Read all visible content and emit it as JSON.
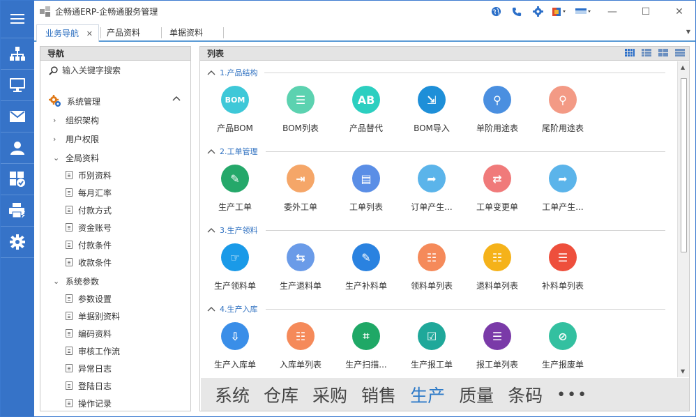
{
  "window": {
    "title": "企畅通ERP-企畅通服务管理",
    "minimize": "—",
    "maximize": "☐",
    "close": "✕"
  },
  "colors": {
    "rail": "#3673c8",
    "accent": "#2d6fc0"
  },
  "rail_items": [
    "menu-icon",
    "org-chart-icon",
    "monitor-icon",
    "mail-icon",
    "user-icon",
    "apps-check-icon",
    "printer-icon",
    "gear-icon"
  ],
  "tabs": [
    {
      "label": "业务导航",
      "active": true,
      "close": "✕"
    },
    {
      "label": "产品资料",
      "active": false
    },
    {
      "label": "单据资料",
      "active": false
    }
  ],
  "nav": {
    "title": "导航",
    "search_placeholder": "输入关键字搜索",
    "root": "系统管理",
    "items": [
      {
        "label": "组织架构",
        "arrow": "›"
      },
      {
        "label": "用户权限",
        "arrow": "›"
      },
      {
        "label": "全局资料",
        "arrow": "⌄"
      },
      {
        "label": "币别资料"
      },
      {
        "label": "每月汇率"
      },
      {
        "label": "付款方式"
      },
      {
        "label": "资金账号"
      },
      {
        "label": "付款条件"
      },
      {
        "label": "收款条件"
      },
      {
        "label": "系统参数",
        "arrow": "⌄"
      },
      {
        "label": "参数设置"
      },
      {
        "label": "单据别资料"
      },
      {
        "label": "编码资料"
      },
      {
        "label": "审核工作流"
      },
      {
        "label": "异常日志"
      },
      {
        "label": "登陆日志"
      },
      {
        "label": "操作记录"
      }
    ]
  },
  "list": {
    "title": "列表",
    "sections": [
      {
        "title": "1.产品结构",
        "tiles": [
          {
            "label": "产品BOM",
            "icon": "bom-icon",
            "color": "#3ec8d8",
            "glyph": "BOM"
          },
          {
            "label": "BOM列表",
            "icon": "bom-list-icon",
            "color": "#5cd2b0",
            "glyph": "☰"
          },
          {
            "label": "产品替代",
            "icon": "substitute-icon",
            "color": "#2ccfc0",
            "glyph": "AB"
          },
          {
            "label": "BOM导入",
            "icon": "import-icon",
            "color": "#1e8fd8",
            "glyph": "⇲"
          },
          {
            "label": "单阶用途表",
            "icon": "single-usage-icon",
            "color": "#4a8fe0",
            "glyph": "⚲"
          },
          {
            "label": "尾阶用途表",
            "icon": "tail-usage-icon",
            "color": "#f39a85",
            "glyph": "⚲"
          }
        ]
      },
      {
        "title": "2.工单管理",
        "tiles": [
          {
            "label": "生产工单",
            "icon": "work-order-icon",
            "color": "#25a86a",
            "glyph": "✎"
          },
          {
            "label": "委外工单",
            "icon": "outsource-icon",
            "color": "#f5a668",
            "glyph": "⇥"
          },
          {
            "label": "工单列表",
            "icon": "order-list-icon",
            "color": "#5a8ee6",
            "glyph": "▤"
          },
          {
            "label": "订单产生...",
            "icon": "share-arrow-icon",
            "color": "#5bb4ea",
            "glyph": "➦"
          },
          {
            "label": "工单变更单",
            "icon": "exchange-icon",
            "color": "#f07a7a",
            "glyph": "⇄"
          },
          {
            "label": "工单产生...",
            "icon": "share-arrow-icon",
            "color": "#5bb4ea",
            "glyph": "➦"
          }
        ]
      },
      {
        "title": "3.生产领料",
        "tiles": [
          {
            "label": "生产领料单",
            "icon": "pick-icon",
            "color": "#1a9ae8",
            "glyph": "☞"
          },
          {
            "label": "生产退料单",
            "icon": "return-icon",
            "color": "#6a9be8",
            "glyph": "⇆"
          },
          {
            "label": "生产补料单",
            "icon": "supplement-icon",
            "color": "#2a82e0",
            "glyph": "✎"
          },
          {
            "label": "领料单列表",
            "icon": "pick-list-icon",
            "color": "#f58a5a",
            "glyph": "☷"
          },
          {
            "label": "退料单列表",
            "icon": "return-list-icon",
            "color": "#f5b21a",
            "glyph": "☷"
          },
          {
            "label": "补料单列表",
            "icon": "supplement-list-icon",
            "color": "#ee4f3c",
            "glyph": "☰"
          }
        ]
      },
      {
        "title": "4.生产入库",
        "tiles": [
          {
            "label": "生产入库单",
            "icon": "inbound-icon",
            "color": "#3a8ee8",
            "glyph": "⇩"
          },
          {
            "label": "入库单列表",
            "icon": "inbound-list-icon",
            "color": "#f58a5a",
            "glyph": "☷"
          },
          {
            "label": "生产扫描...",
            "icon": "scan-icon",
            "color": "#1fa866",
            "glyph": "⌗"
          },
          {
            "label": "生产报工单",
            "icon": "report-icon",
            "color": "#1fa89a",
            "glyph": "☑"
          },
          {
            "label": "报工单列表",
            "icon": "report-list-icon",
            "color": "#7a3aa8",
            "glyph": "☰"
          },
          {
            "label": "生产报废单",
            "icon": "scrap-icon",
            "color": "#33c0a0",
            "glyph": "⊘"
          }
        ]
      }
    ]
  },
  "modules": [
    {
      "label": "系统",
      "active": false
    },
    {
      "label": "仓库",
      "active": false
    },
    {
      "label": "采购",
      "active": false
    },
    {
      "label": "销售",
      "active": false
    },
    {
      "label": "生产",
      "active": true
    },
    {
      "label": "质量",
      "active": false
    },
    {
      "label": "条码",
      "active": false
    }
  ],
  "modules_more": "•••"
}
